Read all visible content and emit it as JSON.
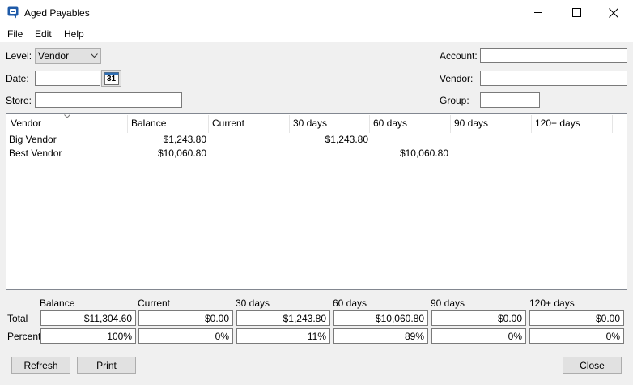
{
  "window": {
    "title": "Aged Payables"
  },
  "menu": {
    "file": "File",
    "edit": "Edit",
    "help": "Help"
  },
  "form": {
    "level_label": "Level:",
    "level_value": "Vendor",
    "date_label": "Date:",
    "date_value": "",
    "calendar_day": "31",
    "store_label": "Store:",
    "store_value": "",
    "account_label": "Account:",
    "account_value": "",
    "vendor_label": "Vendor:",
    "vendor_value": "",
    "group_label": "Group:",
    "group_value": ""
  },
  "grid": {
    "columns": [
      "Vendor",
      "Balance",
      "Current",
      "30 days",
      "60 days",
      "90 days",
      "120+ days"
    ],
    "rows": [
      {
        "vendor": "Big Vendor",
        "balance": "$1,243.80",
        "current": "",
        "d30": "$1,243.80",
        "d60": "",
        "d90": "",
        "d120": ""
      },
      {
        "vendor": "Best Vendor",
        "balance": "$10,060.80",
        "current": "",
        "d30": "",
        "d60": "$10,060.80",
        "d90": "",
        "d120": ""
      }
    ]
  },
  "totals": {
    "headers": [
      "Balance",
      "Current",
      "30 days",
      "60 days",
      "90 days",
      "120+ days"
    ],
    "total_label": "Total",
    "total_values": [
      "$11,304.60",
      "$0.00",
      "$1,243.80",
      "$10,060.80",
      "$0.00",
      "$0.00"
    ],
    "percent_label": "Percent",
    "percent_values": [
      "100%",
      "0%",
      "11%",
      "89%",
      "0%",
      "0%"
    ]
  },
  "buttons": {
    "refresh": "Refresh",
    "print": "Print",
    "close": "Close"
  },
  "colors": {
    "window_bg": "#f0f0f0",
    "app_icon": "#1e5aa8"
  }
}
